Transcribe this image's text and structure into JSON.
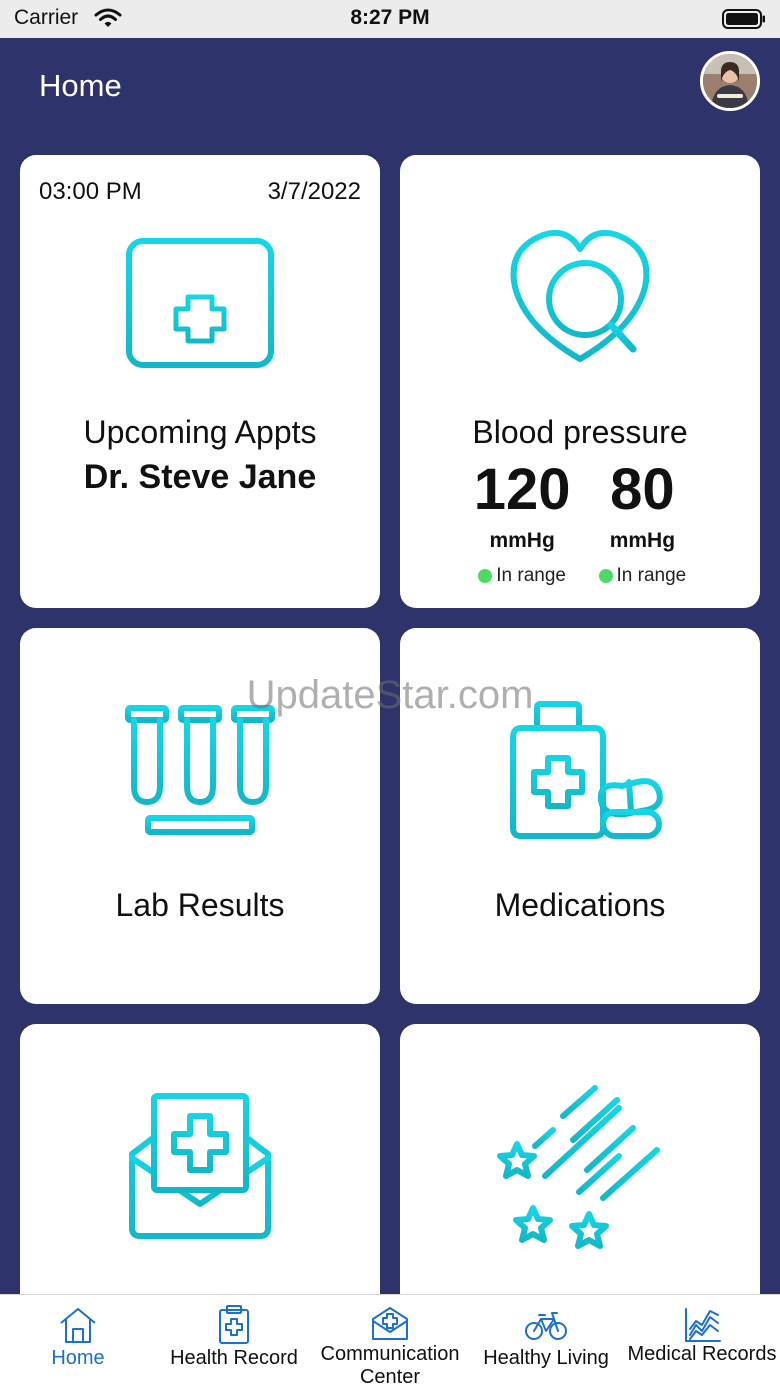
{
  "status_bar": {
    "carrier": "Carrier",
    "time": "8:27 PM"
  },
  "header": {
    "title": "Home"
  },
  "cards": {
    "appointment": {
      "time": "03:00 PM",
      "date": "3/7/2022",
      "title": "Upcoming Appts",
      "doctor": "Dr. Steve Jane",
      "icon": "calendar-medical-icon"
    },
    "blood_pressure": {
      "title": "Blood pressure",
      "icon": "heart-search-icon",
      "systolic": "120",
      "diastolic": "80",
      "systolic_unit": "mmHg",
      "diastolic_unit": "mmHg",
      "systolic_status": "In range",
      "diastolic_status": "In range"
    },
    "lab_results": {
      "title": "Lab Results",
      "icon": "test-tubes-icon"
    },
    "medications": {
      "title": "Medications",
      "icon": "pill-bottle-icon"
    },
    "messages": {
      "icon": "envelope-medical-icon"
    },
    "wellness": {
      "icon": "shooting-stars-icon"
    }
  },
  "watermark": "UpdateStar.com",
  "tabs": [
    {
      "label": "Home",
      "icon": "house-icon",
      "active": true
    },
    {
      "label": "Health Record",
      "icon": "clipboard-medical-icon"
    },
    {
      "label": "Communication Center",
      "icon": "medical-kit-icon"
    },
    {
      "label": "Healthy Living",
      "icon": "bicycle-icon"
    },
    {
      "label": "Medical Records",
      "icon": "chart-icon"
    }
  ],
  "colors": {
    "nav_background": "#2e346b",
    "icon_accent": "#1cc6d6",
    "active_tab": "#1d6fd0",
    "in_range": "#4cd964"
  }
}
